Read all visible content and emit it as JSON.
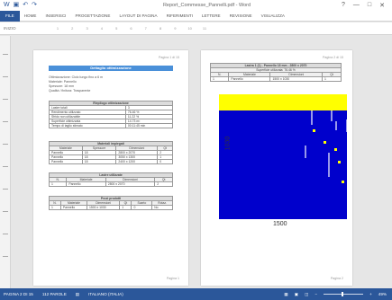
{
  "app": {
    "title": "Report_Commesse_Pannelli.pdf - Word",
    "qat_icons": [
      "word-icon",
      "save-icon",
      "undo-icon",
      "redo-icon"
    ],
    "window_controls": [
      "?",
      "—",
      "□",
      "✕"
    ],
    "accent": "#2b579a"
  },
  "ribbon": {
    "tabs": [
      "FILE",
      "HOME",
      "INSERISCI",
      "PROGETTAZIONE",
      "LAYOUT DI PAGINA",
      "RIFERIMENTI",
      "LETTERE",
      "REVISIONE",
      "VISUALIZZA"
    ]
  },
  "ruler": {
    "label": "INIZIO",
    "ticks": [
      "1",
      "2",
      "3",
      "4",
      "5",
      "6",
      "7",
      "8",
      "9",
      "10",
      "11"
    ]
  },
  "page1": {
    "header": "Pagina 1 di 15",
    "title": "Dettaglio ottimizzazione",
    "info": [
      "Ottimizzazione: Ciclo lungo fino a 6 m",
      "Materiale: Pannello",
      "Spessore: 18 mm",
      "Qualità / finitura: Trasparente"
    ],
    "summary": {
      "title": "Riepilogo ottimizzazione",
      "rows": [
        [
          "Lastre totali",
          "3"
        ],
        [
          "Rendimento utilizzato",
          "76.46 %"
        ],
        [
          "Sfrido non utilizzabile",
          "11.22 %"
        ],
        [
          "Superficie ottimizzata",
          "14.73 m²"
        ],
        [
          "Tempo di taglio stimato",
          "00:11:45 min"
        ]
      ]
    },
    "materials": {
      "title": "Materiali impiegati",
      "headers": [
        "Materiale",
        "Spessore",
        "Dimensioni",
        "Qt"
      ],
      "rows": [
        [
          "Pannello",
          "18",
          "2800 x 2070",
          "2"
        ],
        [
          "Pannello",
          "18",
          "3050 x 1300",
          "1"
        ],
        [
          "Pannello",
          "18",
          "2400 x 1200",
          "0"
        ]
      ]
    },
    "sheets": {
      "title": "Lastre utilizzate",
      "headers": [
        "N.",
        "Materiale",
        "Dimensioni",
        "Qt"
      ],
      "rows": [
        [
          "1",
          "Pannello",
          "2800 x 2070",
          "2"
        ]
      ]
    },
    "pieces": {
      "title": "Pezzi prodotti",
      "headers": [
        "N.",
        "Materiale",
        "Dimensioni",
        "Qt",
        "Scarto",
        "Rotaz."
      ],
      "rows": [
        [
          "1",
          "Pannello",
          "1500 x 1030",
          "1",
          "0",
          "No"
        ]
      ]
    },
    "footer": "Pagina 1"
  },
  "page2": {
    "header": "Pagina 2 di 15",
    "table_title": "Lastra 1 (1) - Pannello 18 mm - 2800 x 2070",
    "table_subtitle": "Superficie utilizzata: 76.46 %",
    "headers": [
      "N.",
      "Materiale",
      "Dimensioni",
      "Qt"
    ],
    "rows": [
      [
        "1",
        "Pannello",
        "1500 x 1030",
        "1"
      ]
    ],
    "footer": "Pagina 2"
  },
  "chart_data": {
    "type": "heatmap",
    "title": "",
    "xlabel": "1500",
    "ylabel": "1030",
    "legend": "none",
    "colors": {
      "piece": "#0000cc",
      "waste": "#ffff00",
      "lines": "#ffffff"
    },
    "regions": [
      {
        "name": "",
        "x": [
          0,
          142
        ],
        "y": [
          0,
          18
        ],
        "color": "waste"
      },
      {
        "name": "",
        "x": [
          0,
          142
        ],
        "y": [
          18,
          139
        ],
        "color": "piece"
      }
    ]
  },
  "status": {
    "page": "PAGINA 2 DI 15",
    "words": "112 PAROLE",
    "language": "ITALIANO (ITALIA)",
    "zoom": "49%"
  }
}
